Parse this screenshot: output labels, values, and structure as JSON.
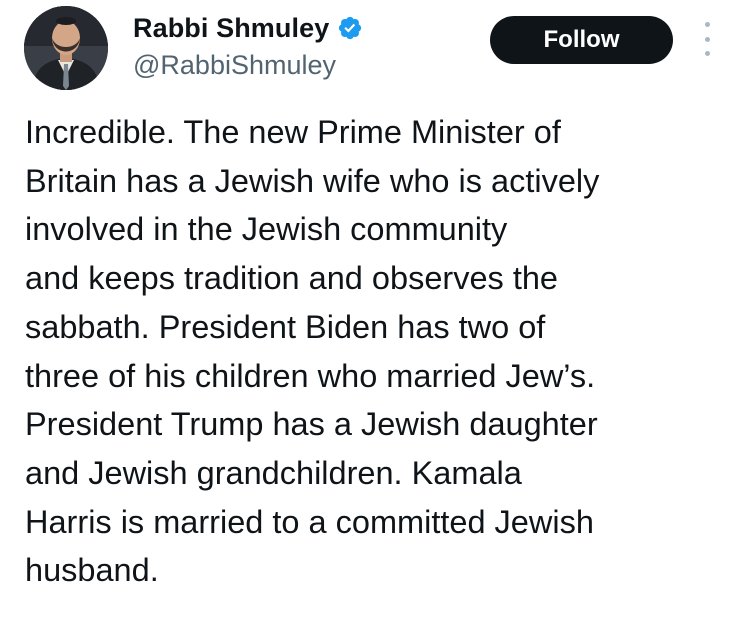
{
  "author": {
    "display_name": "Rabbi Shmuley",
    "handle": "@RabbiShmuley",
    "verified": true
  },
  "actions": {
    "follow_label": "Follow"
  },
  "tweet": {
    "lines": [
      "Incredible. The new Prime Minister of",
      "Britain has a Jewish wife who is actively",
      "involved in the Jewish community",
      "and keeps tradition and observes the",
      "sabbath. President Biden has two of",
      "three of his children who married Jew’s.",
      "President Trump has a Jewish daughter",
      "and Jewish grandchildren. Kamala",
      "Harris is married to a committed Jewish",
      "husband."
    ]
  },
  "icons": {
    "verified": "verified-badge-icon",
    "more": "more-options-icon"
  },
  "colors": {
    "text_primary": "#0f1419",
    "text_secondary": "#536471",
    "follow_button_bg": "#0f1419",
    "follow_button_text": "#ffffff",
    "verified_badge": "#1d9bf0"
  }
}
